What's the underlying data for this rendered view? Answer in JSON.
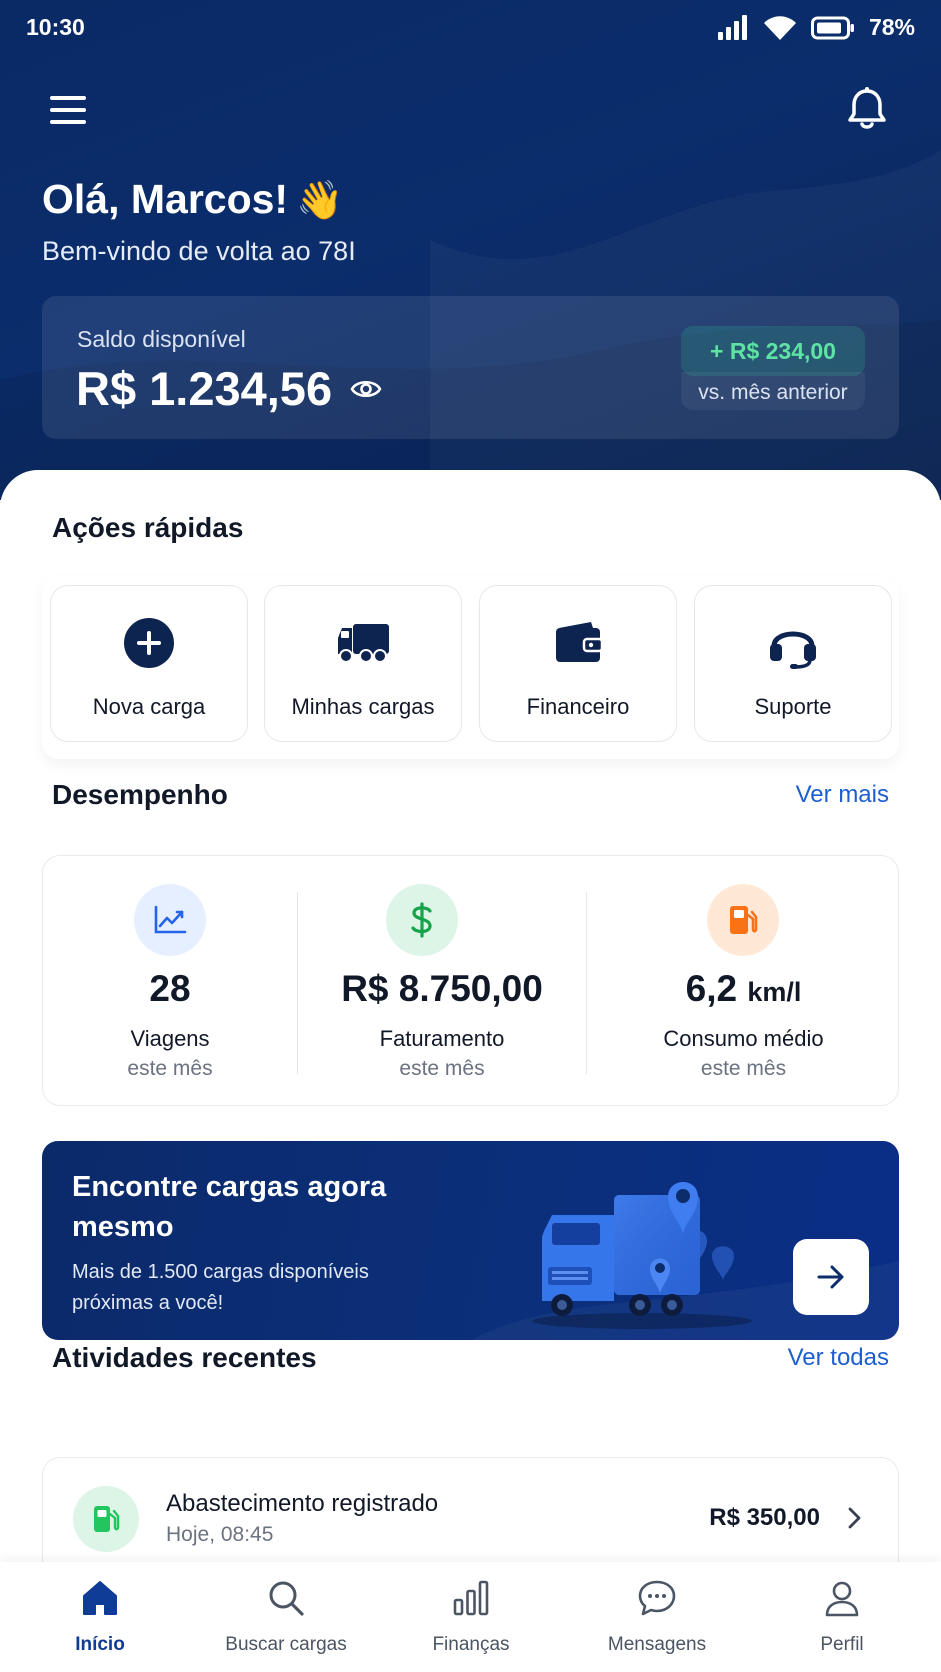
{
  "status_bar": {
    "time": "10:30",
    "battery": "78%"
  },
  "header": {
    "greeting": "Olá, Marcos!",
    "greeting_emoji": "👋",
    "subtitle": "Bem-vindo de volta ao 78I"
  },
  "balance": {
    "label": "Saldo disponível",
    "value": "R$ 1.234,56",
    "delta": "+ R$ 234,00",
    "delta_caption": "vs. mês anterior"
  },
  "quick_actions": {
    "title": "Ações rápidas",
    "items": [
      {
        "label": "Nova carga",
        "icon": "plus-circle-icon"
      },
      {
        "label": "Minhas cargas",
        "icon": "truck-icon"
      },
      {
        "label": "Financeiro",
        "icon": "wallet-icon"
      },
      {
        "label": "Suporte",
        "icon": "headset-icon"
      }
    ]
  },
  "performance": {
    "title": "Desempenho",
    "link": "Ver mais",
    "stats": [
      {
        "value": "28",
        "unit": "",
        "label": "Viagens",
        "period": "este mês",
        "icon": "trend-chart-icon",
        "icon_color": "#2563eb",
        "icon_bg": "#e6efff"
      },
      {
        "value": "R$ 8.750,00",
        "unit": "",
        "label": "Faturamento",
        "period": "este mês",
        "icon": "dollar-icon",
        "icon_color": "#16a34a",
        "icon_bg": "#dcf5e6"
      },
      {
        "value": "6,2",
        "unit": "km/l",
        "label": "Consumo médio",
        "period": "este mês",
        "icon": "fuel-pump-icon",
        "icon_color": "#f97316",
        "icon_bg": "#ffe9d6"
      }
    ]
  },
  "promo": {
    "title": "Encontre cargas agora mesmo",
    "text": "Mais de 1.500 cargas disponíveis próximas a você!"
  },
  "activities": {
    "title": "Atividades recentes",
    "link": "Ver todas",
    "items": [
      {
        "title": "Abastecimento registrado",
        "time": "Hoje, 08:45",
        "amount": "R$ 350,00",
        "icon": "fuel-pump-icon"
      }
    ]
  },
  "bottom_nav": {
    "items": [
      {
        "label": "Início",
        "icon": "home-icon",
        "active": true
      },
      {
        "label": "Buscar cargas",
        "icon": "search-icon",
        "active": false
      },
      {
        "label": "Finanças",
        "icon": "bar-chart-icon",
        "active": false
      },
      {
        "label": "Mensagens",
        "icon": "chat-icon",
        "active": false
      },
      {
        "label": "Perfil",
        "icon": "user-icon",
        "active": false
      }
    ]
  },
  "colors": {
    "hero_bg": "#0b2d6b",
    "accent_blue": "#1d5fd1",
    "positive_green": "#5ee3a4",
    "active_nav": "#0f3c96"
  }
}
